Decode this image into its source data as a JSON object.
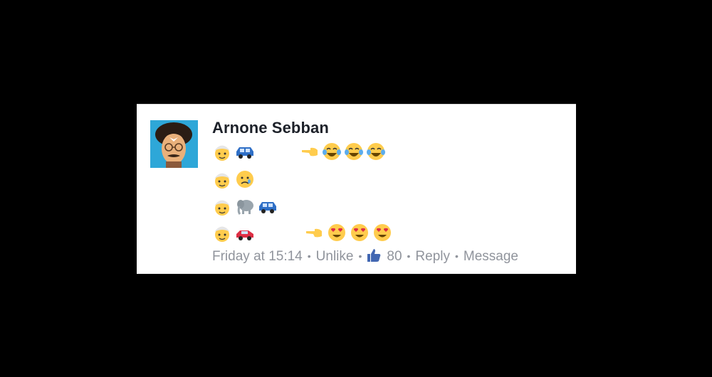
{
  "comment": {
    "author": "Arnone Sebban",
    "lines": [
      [
        "man-with-turban",
        "blue-car",
        "gap",
        "pointing-left-hand",
        "tears-of-joy",
        "tears-of-joy",
        "tears-of-joy"
      ],
      [
        "man-with-turban",
        "crying-face"
      ],
      [
        "man-with-turban",
        "elephant",
        "blue-car"
      ],
      [
        "man-with-turban",
        "red-car",
        "gap",
        "pointing-left-hand",
        "heart-eyes",
        "heart-eyes",
        "heart-eyes"
      ]
    ],
    "timestamp": "Friday at 15:14",
    "unlike_label": "Unlike",
    "like_count": "80",
    "reply_label": "Reply",
    "message_label": "Message"
  },
  "colors": {
    "background": "#000000",
    "card": "#ffffff",
    "meta_text": "#90949c",
    "author_text": "#1d2129",
    "like_blue": "#4267b2"
  }
}
